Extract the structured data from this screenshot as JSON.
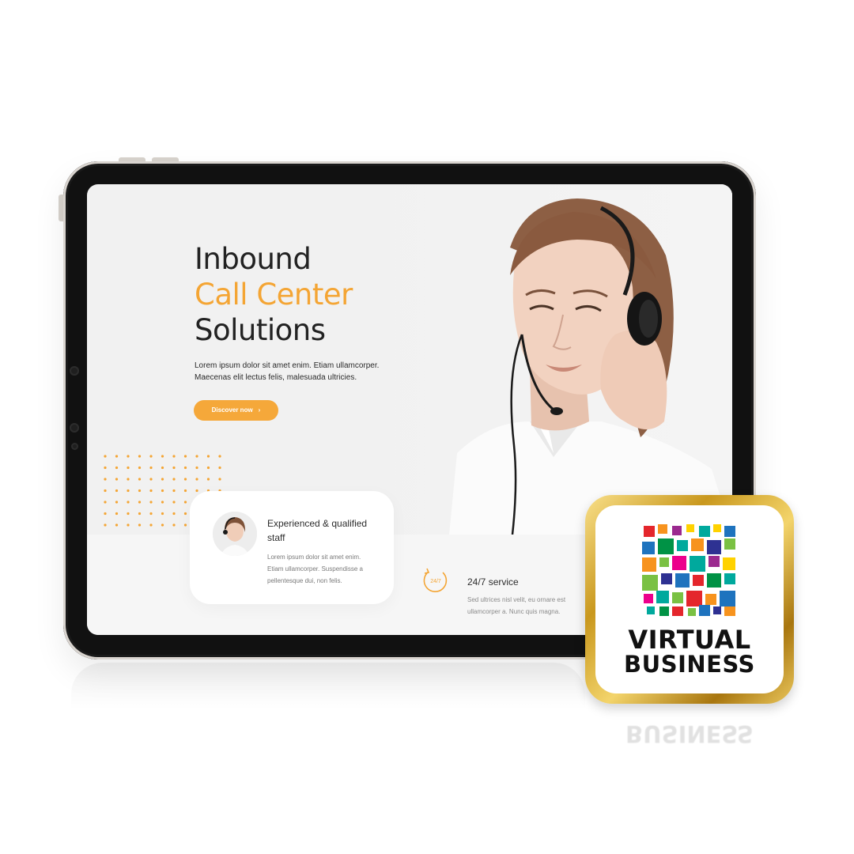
{
  "hero": {
    "title_line1": "Inbound",
    "title_line2": "Call Center",
    "title_line3": "Solutions",
    "description": "Lorem ipsum dolor sit amet enim. Etiam ullamcorper. Maecenas elit lectus felis, malesuada ultricies.",
    "cta_label": "Discover now",
    "cta_icon": "chevron-right-icon"
  },
  "features": [
    {
      "title": "Experienced & qualified staff",
      "text": "Lorem ipsum dolor sit amet enim. Etiam ullamcorper. Suspendisse a pellentesque dui, non felis."
    },
    {
      "title": "24/7 service",
      "text": "Sed ultrices nisl velit, eu ornare est ullamcorper a. Nunc quis magna.",
      "icon": "clock-24-7-icon",
      "icon_text": "24/7"
    }
  ],
  "badge": {
    "line1": "VIRTUAL",
    "line2": "BUSINESS",
    "reflection": "BUSINESS"
  },
  "colors": {
    "accent": "#f4a534",
    "text": "#222222",
    "muted": "#7a7a7a",
    "gold": "#d4a52a"
  }
}
